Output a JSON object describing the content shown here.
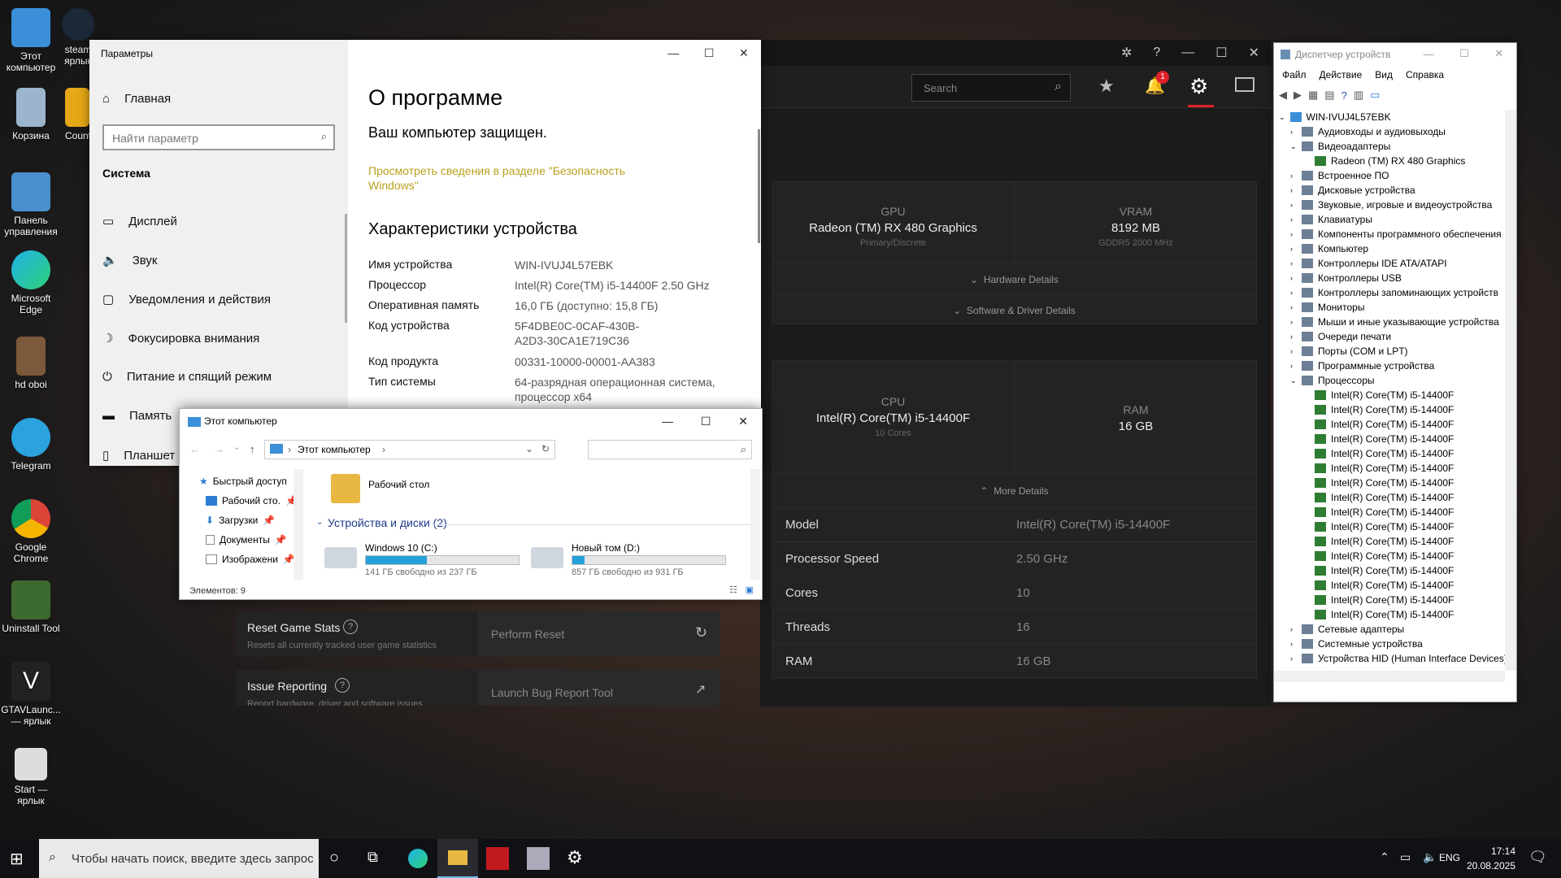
{
  "desktop": {
    "icons": [
      {
        "label": "Этот компьютер"
      },
      {
        "label": "steam ярлык"
      },
      {
        "label": "Корзина"
      },
      {
        "label": "Count"
      },
      {
        "label": "Панель управления"
      },
      {
        "label": "Microsoft Edge"
      },
      {
        "label": "hd oboi"
      },
      {
        "label": "Telegram"
      },
      {
        "label": "Google Chrome"
      },
      {
        "label": "Uninstall Tool"
      },
      {
        "label": "GTAVLaunc... — ярлык"
      },
      {
        "label": "Start — ярлык"
      }
    ]
  },
  "amd": {
    "search_placeholder": "Search",
    "notification_count": "1",
    "gpu": {
      "title": "GPU",
      "name": "Radeon (TM) RX 480 Graphics",
      "sub": "Primary/Discrete"
    },
    "vram": {
      "title": "VRAM",
      "value": "8192 MB",
      "sub": "GDDR5 2000 MHz"
    },
    "hardware_details": "Hardware Details",
    "software_details": "Software & Driver Details",
    "cpu": {
      "title": "CPU",
      "name": "Intel(R) Core(TM) i5-14400F",
      "sub": "10 Cores"
    },
    "ram": {
      "title": "RAM",
      "value": "16 GB"
    },
    "more_details": "More Details",
    "details": [
      {
        "k": "Model",
        "v": "Intel(R) Core(TM) i5-14400F"
      },
      {
        "k": "Processor Speed",
        "v": "2.50 GHz"
      },
      {
        "k": "Cores",
        "v": "10"
      },
      {
        "k": "Threads",
        "v": "16"
      },
      {
        "k": "RAM",
        "v": "16 GB"
      }
    ],
    "reset_stats": {
      "title": "Reset Game Stats",
      "desc": "Resets all currently tracked user game statistics",
      "action": "Perform Reset"
    },
    "issue": {
      "title": "Issue Reporting",
      "desc": "Report hardware, driver and software issues",
      "action": "Launch Bug Report Tool"
    }
  },
  "settings": {
    "window_title": "Параметры",
    "home": "Главная",
    "search_placeholder": "Найти параметр",
    "section": "Система",
    "nav": [
      "Дисплей",
      "Звук",
      "Уведомления и действия",
      "Фокусировка внимания",
      "Питание и спящий режим",
      "Память",
      "Планшет"
    ],
    "page_title": "О программе",
    "protected": "Ваш компьютер защищен.",
    "security_link": "Просмотреть сведения в разделе \"Безопасность Windows\"",
    "spec_title": "Характеристики устройства",
    "specs": [
      {
        "k": "Имя устройства",
        "v": "WIN-IVUJ4L57EBK"
      },
      {
        "k": "Процессор",
        "v": "Intel(R) Core(TM) i5-14400F   2.50 GHz"
      },
      {
        "k": "Оперативная память",
        "v": "16,0 ГБ (доступно: 15,8 ГБ)"
      },
      {
        "k": "Код устройства",
        "v": "5F4DBE0C-0CAF-430B-A2D3-30CA1E719C36"
      },
      {
        "k": "Код продукта",
        "v": "00331-10000-00001-AA383"
      },
      {
        "k": "Тип системы",
        "v": "64-разрядная операционная система, процессор x64"
      }
    ]
  },
  "explorer": {
    "title": "Этот компьютер",
    "address": "Этот компьютер",
    "quick": [
      "Быстрый доступ",
      "Рабочий сто.",
      "Загрузки",
      "Документы",
      "Изображени"
    ],
    "folder": "Рабочий стол",
    "group": "Устройства и диски (2)",
    "drives": [
      {
        "name": "Windows 10 (C:)",
        "free": "141 ГБ свободно из 237 ГБ",
        "used_pct": 40
      },
      {
        "name": "Новый том (D:)",
        "free": "857 ГБ свободно из 931 ГБ",
        "used_pct": 8
      }
    ],
    "status": "Элементов: 9"
  },
  "devmgr": {
    "title": "Диспетчер устройств",
    "menu": [
      "Файл",
      "Действие",
      "Вид",
      "Справка"
    ],
    "root": "WIN-IVUJ4L57EBK",
    "items": [
      {
        "label": "Аудиовходы и аудиовыходы",
        "level": 1
      },
      {
        "label": "Видеоадаптеры",
        "level": 1
      },
      {
        "label": "Radeon (TM) RX 480 Graphics",
        "level": 2
      },
      {
        "label": "Встроенное ПО",
        "level": 1
      },
      {
        "label": "Дисковые устройства",
        "level": 1
      },
      {
        "label": "Звуковые, игровые и видеоустройства",
        "level": 1
      },
      {
        "label": "Клавиатуры",
        "level": 1
      },
      {
        "label": "Компоненты программного обеспечения",
        "level": 1
      },
      {
        "label": "Компьютер",
        "level": 1
      },
      {
        "label": "Контроллеры IDE ATA/ATAPI",
        "level": 1
      },
      {
        "label": "Контроллеры USB",
        "level": 1
      },
      {
        "label": "Контроллеры запоминающих устройств",
        "level": 1
      },
      {
        "label": "Мониторы",
        "level": 1
      },
      {
        "label": "Мыши и иные указывающие устройства",
        "level": 1
      },
      {
        "label": "Очереди печати",
        "level": 1
      },
      {
        "label": "Порты (COM и LPT)",
        "level": 1
      },
      {
        "label": "Программные устройства",
        "level": 1
      },
      {
        "label": "Процессоры",
        "level": 1
      },
      {
        "label": "Intel(R) Core(TM) i5-14400F",
        "level": 2
      },
      {
        "label": "Intel(R) Core(TM) i5-14400F",
        "level": 2
      },
      {
        "label": "Intel(R) Core(TM) i5-14400F",
        "level": 2
      },
      {
        "label": "Intel(R) Core(TM) i5-14400F",
        "level": 2
      },
      {
        "label": "Intel(R) Core(TM) i5-14400F",
        "level": 2
      },
      {
        "label": "Intel(R) Core(TM) i5-14400F",
        "level": 2
      },
      {
        "label": "Intel(R) Core(TM) i5-14400F",
        "level": 2
      },
      {
        "label": "Intel(R) Core(TM) i5-14400F",
        "level": 2
      },
      {
        "label": "Intel(R) Core(TM) i5-14400F",
        "level": 2
      },
      {
        "label": "Intel(R) Core(TM) i5-14400F",
        "level": 2
      },
      {
        "label": "Intel(R) Core(TM) i5-14400F",
        "level": 2
      },
      {
        "label": "Intel(R) Core(TM) i5-14400F",
        "level": 2
      },
      {
        "label": "Intel(R) Core(TM) i5-14400F",
        "level": 2
      },
      {
        "label": "Intel(R) Core(TM) i5-14400F",
        "level": 2
      },
      {
        "label": "Intel(R) Core(TM) i5-14400F",
        "level": 2
      },
      {
        "label": "Intel(R) Core(TM) i5-14400F",
        "level": 2
      },
      {
        "label": "Сетевые адаптеры",
        "level": 1
      },
      {
        "label": "Системные устройства",
        "level": 1
      },
      {
        "label": "Устройства HID (Human Interface Devices)",
        "level": 1
      }
    ]
  },
  "taskbar": {
    "search_placeholder": "Чтобы начать поиск, введите здесь запрос",
    "lang": "ENG",
    "time": "17:14",
    "date": "20.08.2025"
  }
}
